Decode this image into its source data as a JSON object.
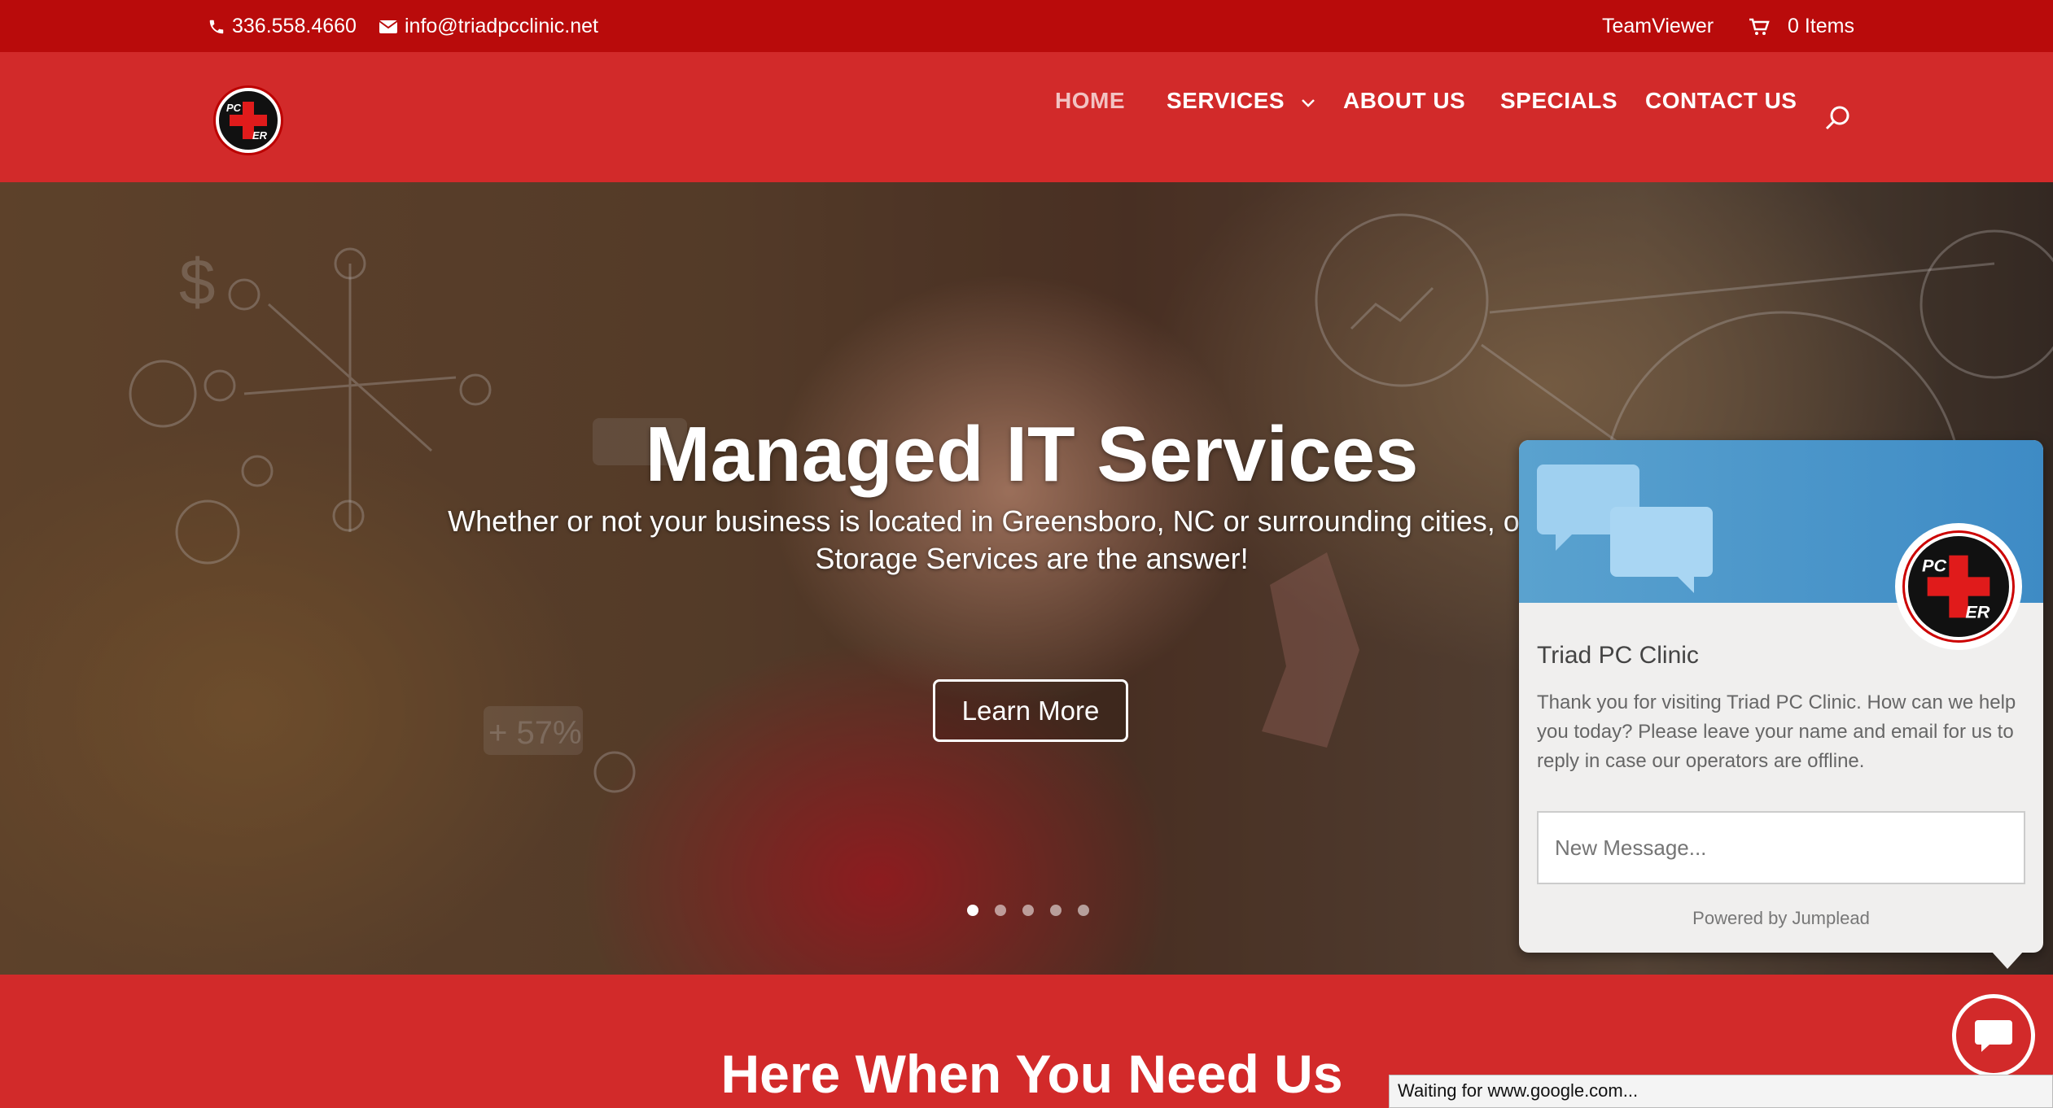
{
  "topbar": {
    "phone": "336.558.4660",
    "email": "info@triadpcclinic.net",
    "teamviewer": "TeamViewer",
    "cart": "0 Items"
  },
  "logo": {
    "line1": "PC",
    "line2": "ER"
  },
  "nav": {
    "items": [
      {
        "label": "HOME",
        "active": true
      },
      {
        "label": "SERVICES",
        "dropdown": true
      },
      {
        "label": "ABOUT US"
      },
      {
        "label": "SPECIALS"
      },
      {
        "label": "CONTACT US"
      }
    ]
  },
  "hero": {
    "title": "Managed IT Services",
    "subtitle": "Whether or not your business is located in Greensboro, NC or surrounding cities, our Data Storage Services are the answer!",
    "button": "Learn More",
    "slides": 5,
    "active_slide": 1
  },
  "section2": {
    "heading": "Here When You Need Us"
  },
  "chat": {
    "name": "Triad PC Clinic",
    "message": "Thank you for visiting Triad PC Clinic. How can we help you today? Please leave your name and email for us to reply in case our operators are offline.",
    "placeholder": "New Message...",
    "powered": "Powered by Jumplead"
  },
  "status_bar": "Waiting for www.google.com..."
}
